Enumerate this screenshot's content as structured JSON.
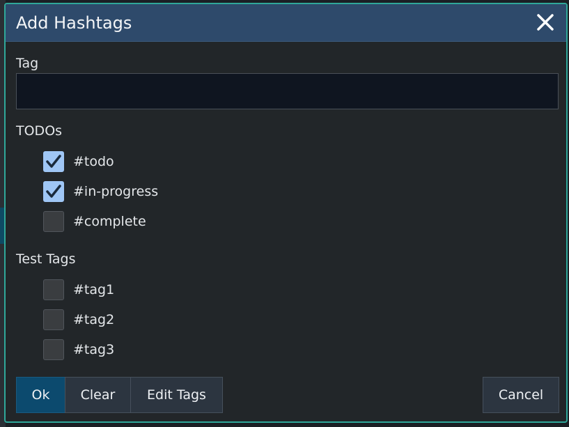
{
  "dialog": {
    "title": "Add Hashtags",
    "close_icon": "close-icon"
  },
  "tag_field": {
    "label": "Tag",
    "value": "",
    "placeholder": ""
  },
  "groups": [
    {
      "heading": "TODOs",
      "items": [
        {
          "label": "#todo",
          "checked": true
        },
        {
          "label": "#in-progress",
          "checked": true
        },
        {
          "label": "#complete",
          "checked": false
        }
      ]
    },
    {
      "heading": "Test Tags",
      "items": [
        {
          "label": "#tag1",
          "checked": false
        },
        {
          "label": "#tag2",
          "checked": false
        },
        {
          "label": "#tag3",
          "checked": false
        }
      ]
    }
  ],
  "buttons": {
    "ok": "Ok",
    "clear": "Clear",
    "edit_tags": "Edit Tags",
    "cancel": "Cancel"
  },
  "colors": {
    "accent_border": "#2fa89a",
    "titlebar": "#2e4a6b",
    "checked": "#9fc6f5",
    "primary_button": "#0c4a6e"
  }
}
